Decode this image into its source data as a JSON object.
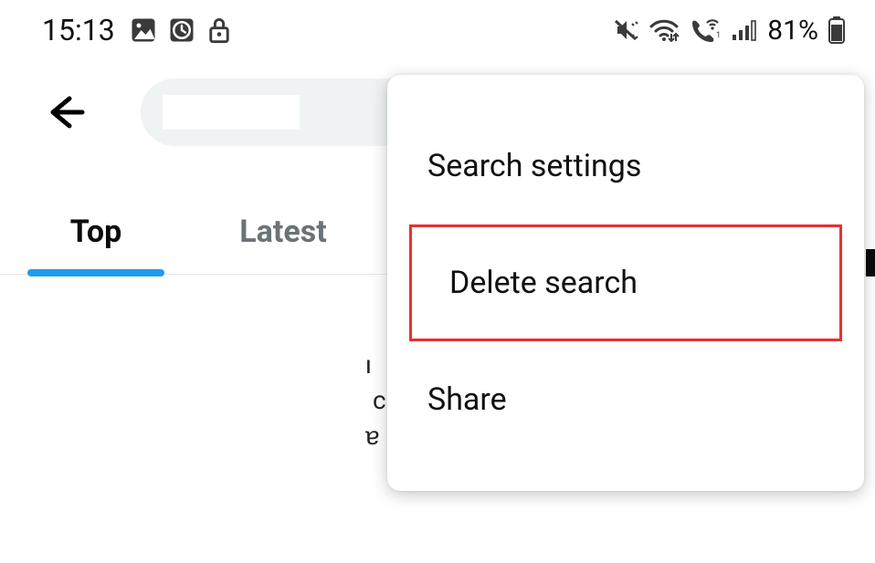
{
  "status_bar": {
    "time": "15:13",
    "battery_text": "81%"
  },
  "tabs": {
    "top": "Top",
    "latest": "Latest"
  },
  "menu": {
    "search_settings": "Search settings",
    "delete_search": "Delete search",
    "share": "Share"
  },
  "icons": {
    "image": "image-icon",
    "clock": "clock-icon",
    "lock": "lock-icon",
    "mute": "mute-vibrate-icon",
    "wifi": "wifi-icon",
    "wifi_calling": "wifi-calling-icon",
    "signal": "signal-icon",
    "battery": "battery-icon",
    "back": "back-arrow-icon"
  }
}
